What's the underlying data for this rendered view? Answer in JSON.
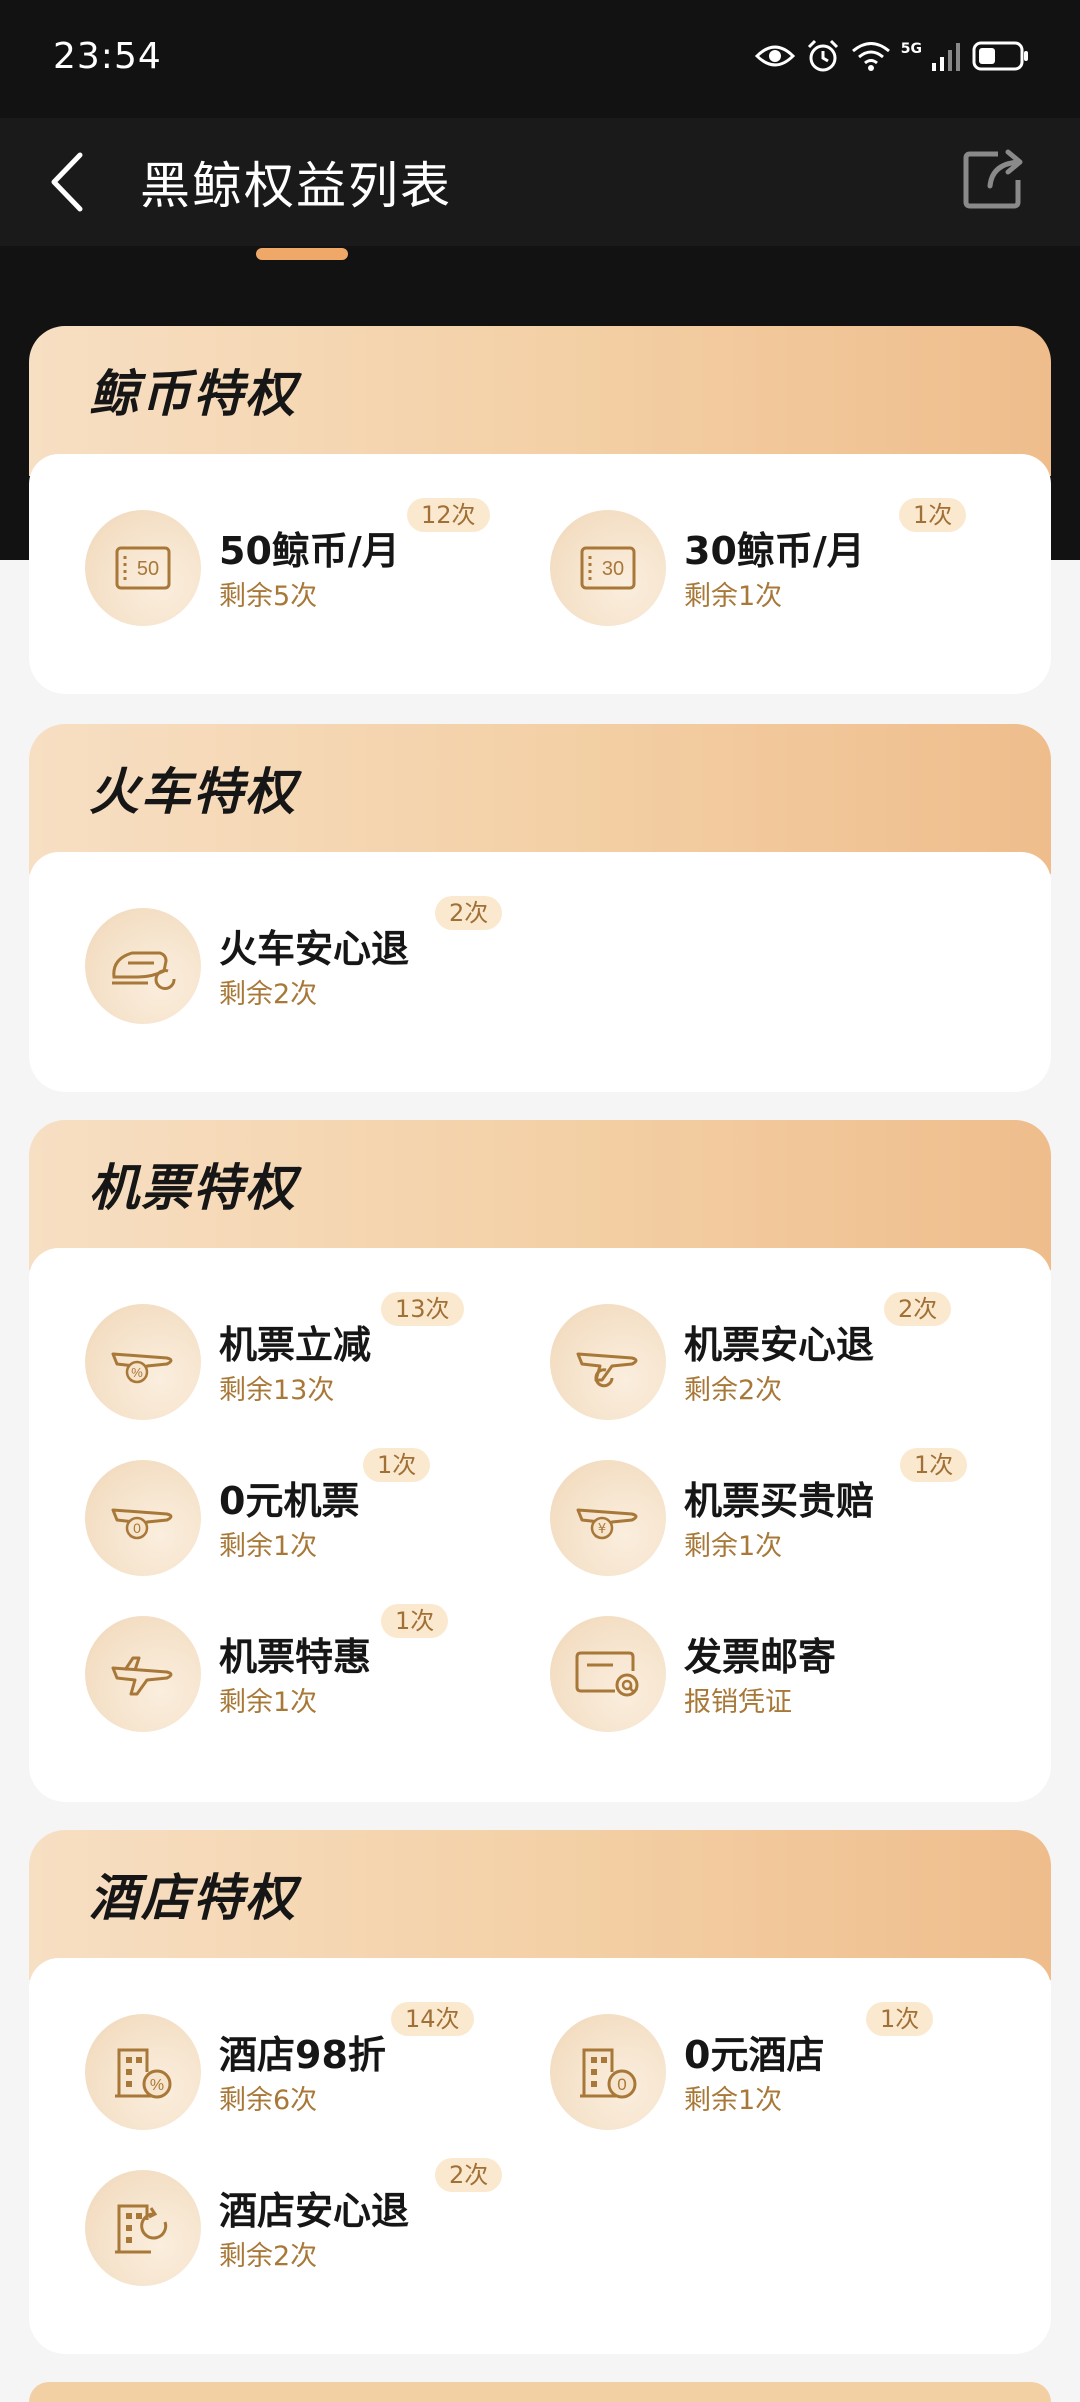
{
  "status": {
    "time": "23:54",
    "network": "5G"
  },
  "nav": {
    "title": "黑鲸权益列表"
  },
  "colors": {
    "accent": "#f0a868",
    "badge_bg": "#fbe9cf",
    "sub_text": "#a87838",
    "header_gradient_end": "#efbd8c"
  },
  "sections": [
    {
      "title": "鲸币特权",
      "items": [
        {
          "icon": "coin-ticket-50-icon",
          "icon_text": "50",
          "name": "50鲸币/月",
          "sub": "剩余5次",
          "badge": "12次"
        },
        {
          "icon": "coin-ticket-30-icon",
          "icon_text": "30",
          "name": "30鲸币/月",
          "sub": "剩余1次",
          "badge": "1次"
        }
      ]
    },
    {
      "title": "火车特权",
      "items": [
        {
          "icon": "train-refund-icon",
          "name": "火车安心退",
          "sub": "剩余2次",
          "badge": "2次"
        }
      ]
    },
    {
      "title": "机票特权",
      "items": [
        {
          "icon": "plane-discount-icon",
          "name": "机票立减",
          "sub": "剩余13次",
          "badge": "13次"
        },
        {
          "icon": "plane-refund-icon",
          "name": "机票安心退",
          "sub": "剩余2次",
          "badge": "2次"
        },
        {
          "icon": "plane-free-icon",
          "icon_text": "0",
          "name": "0元机票",
          "sub": "剩余1次",
          "badge": "1次"
        },
        {
          "icon": "plane-price-guarantee-icon",
          "icon_text": "¥",
          "name": "机票买贵赔",
          "sub": "剩余1次",
          "badge": "1次"
        },
        {
          "icon": "plane-special-icon",
          "name": "机票特惠",
          "sub": "剩余1次",
          "badge": "1次"
        },
        {
          "icon": "invoice-mail-icon",
          "name": "发票邮寄",
          "sub": "报销凭证",
          "badge": ""
        }
      ]
    },
    {
      "title": "酒店特权",
      "items": [
        {
          "icon": "hotel-discount-icon",
          "name": "酒店98折",
          "sub": "剩余6次",
          "badge": "14次"
        },
        {
          "icon": "hotel-free-icon",
          "icon_text": "0",
          "name": "0元酒店",
          "sub": "剩余1次",
          "badge": "1次"
        },
        {
          "icon": "hotel-refund-icon",
          "name": "酒店安心退",
          "sub": "剩余2次",
          "badge": "2次"
        }
      ]
    }
  ]
}
